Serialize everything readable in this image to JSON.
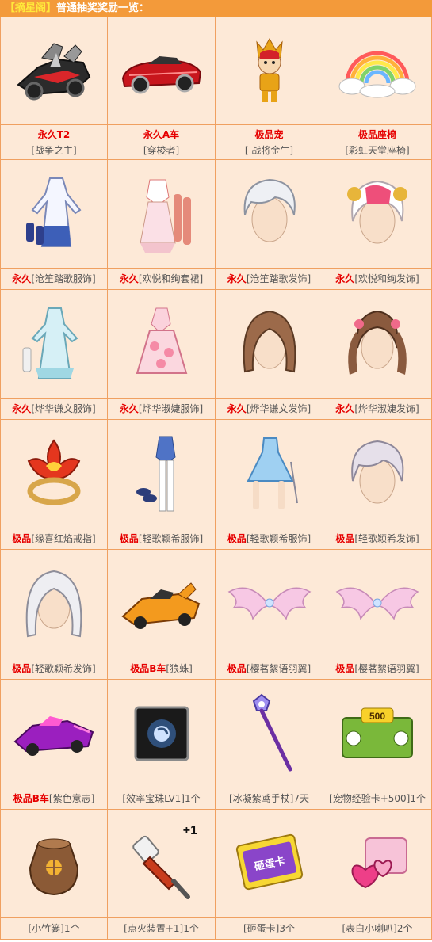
{
  "header": {
    "tag": "【摘星阁】",
    "title": "普通抽奖奖励一览："
  },
  "rows": [
    [
      {
        "line1": "永久T2",
        "line2": "[战争之主]",
        "icon": "mech-car-icon"
      },
      {
        "line1": "永久A车",
        "line2": "[穿梭者]",
        "icon": "red-sports-car-icon"
      },
      {
        "line1": "极品宠",
        "line2": "[ 战将金牛]",
        "icon": "golden-warrior-pet-icon"
      },
      {
        "line1": "极品座椅",
        "line2": "[彩虹天堂座椅]",
        "icon": "rainbow-cloud-seat-icon"
      }
    ],
    [
      {
        "prefix": "永久",
        "text": "[沧笙踏歌服饰]",
        "icon": "white-blue-dress-icon"
      },
      {
        "prefix": "永久",
        "text": "[欢悦和绚套裙]",
        "icon": "pink-dress-set-icon"
      },
      {
        "prefix": "永久",
        "text": "[沧笙踏歌发饰]",
        "icon": "silver-hair-icon"
      },
      {
        "prefix": "永久",
        "text": "[欢悦和绚发饰]",
        "icon": "pink-hair-icon"
      }
    ],
    [
      {
        "prefix": "永久",
        "text": "[烨华谦文服饰]",
        "icon": "light-blue-dress-icon"
      },
      {
        "prefix": "永久",
        "text": "[烨华淑婕服饰]",
        "icon": "pink-flower-dress-icon"
      },
      {
        "prefix": "永久",
        "text": "[烨华谦文发饰]",
        "icon": "brown-hair-icon"
      },
      {
        "prefix": "永久",
        "text": "[烨华淑婕发饰]",
        "icon": "brown-twintail-hair-icon"
      }
    ],
    [
      {
        "prefix": "极品",
        "text": "[缘喜红焰戒指]",
        "icon": "red-flame-ring-icon"
      },
      {
        "prefix": "极品",
        "text": "[轻歌颖希服饰]",
        "icon": "white-blue-suit-icon"
      },
      {
        "prefix": "极品",
        "text": "[轻歌颖希服饰]",
        "icon": "blue-dress-icon"
      },
      {
        "prefix": "极品",
        "text": "[轻歌颖希发饰]",
        "icon": "silver-short-hair-icon"
      }
    ],
    [
      {
        "prefix": "极品",
        "text": "[轻歌颖希发饰]",
        "icon": "silver-long-hair-icon"
      },
      {
        "prefix": "极品B车",
        "text": "[狼蛛]",
        "icon": "orange-race-car-icon"
      },
      {
        "prefix": "极品",
        "text": "[樱茗絮语羽翼]",
        "icon": "pink-wings-icon"
      },
      {
        "prefix": "极品",
        "text": "[樱茗絮语羽翼]",
        "icon": "pink-wings-icon"
      }
    ],
    [
      {
        "prefix": "极品B车",
        "text": "[紫色意志]",
        "icon": "purple-race-car-icon"
      },
      {
        "prefix": "",
        "text": "[效率宝珠LV1]1个",
        "icon": "efficiency-orb-icon"
      },
      {
        "prefix": "",
        "text": "[冰凝紫鸢手杖]7天",
        "icon": "purple-scepter-icon"
      },
      {
        "prefix": "",
        "text": "[宠物经验卡+500]1个",
        "icon": "pet-exp-card-icon"
      }
    ],
    [
      {
        "prefix": "",
        "text": "[小竹篓]1个",
        "icon": "bamboo-basket-icon"
      },
      {
        "prefix": "",
        "text": "[点火装置+1]1个",
        "icon": "ignition-device-icon",
        "badge": "+1"
      },
      {
        "prefix": "",
        "text": "[砸蛋卡]3个",
        "icon": "egg-smash-card-icon",
        "cardtext": "砸蛋卡"
      },
      {
        "prefix": "",
        "text": "[表白小喇叭]2个",
        "icon": "love-horn-icon"
      }
    ]
  ]
}
